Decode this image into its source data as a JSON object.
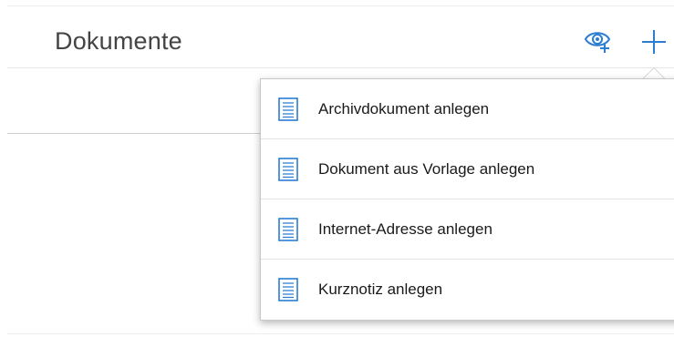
{
  "header": {
    "title": "Dokumente",
    "icons": {
      "visibility": "eye-add-icon",
      "add": "plus-icon"
    }
  },
  "menu": {
    "items": [
      {
        "label": "Archivdokument anlegen",
        "icon": "document-icon"
      },
      {
        "label": "Dokument aus Vorlage anlegen",
        "icon": "document-icon"
      },
      {
        "label": "Internet-Adresse anlegen",
        "icon": "document-icon"
      },
      {
        "label": "Kurznotiz anlegen",
        "icon": "document-icon"
      }
    ]
  },
  "colors": {
    "accent": "#2b7cd3",
    "text": "#1a1a1a",
    "title": "#444444"
  }
}
